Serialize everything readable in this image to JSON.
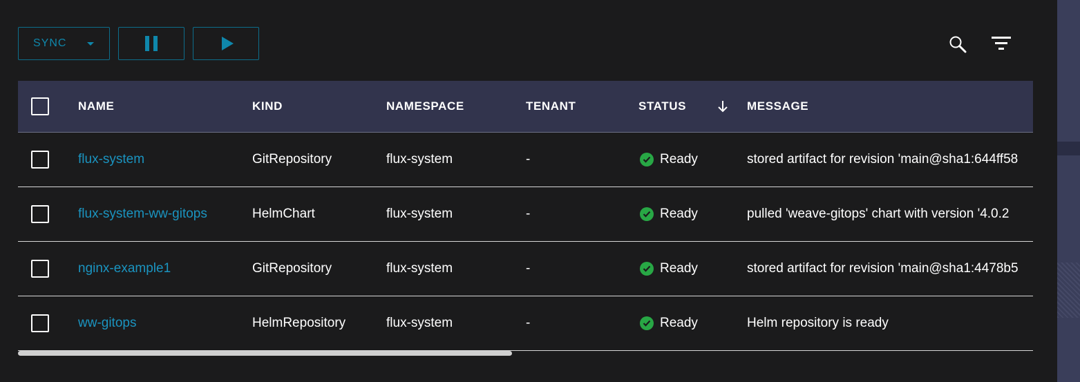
{
  "toolbar": {
    "sync_label": "SYNC"
  },
  "icons": {
    "search": "search-icon",
    "filter": "filter-icon",
    "pause": "pause-icon",
    "play": "play-icon",
    "sort": "arrow-down-icon",
    "status_ready": "check-circle-icon"
  },
  "colors": {
    "accent": "#0f87ab",
    "link": "#1b94c0",
    "header_bg": "#32344d",
    "ready_green": "#28a745"
  },
  "table": {
    "columns": [
      "NAME",
      "KIND",
      "NAMESPACE",
      "TENANT",
      "STATUS",
      "MESSAGE"
    ],
    "rows": [
      {
        "name": "flux-system",
        "kind": "GitRepository",
        "namespace": "flux-system",
        "tenant": "-",
        "status": "Ready",
        "message": "stored artifact for revision 'main@sha1:644ff58"
      },
      {
        "name": "flux-system-ww-gitops",
        "kind": "HelmChart",
        "namespace": "flux-system",
        "tenant": "-",
        "status": "Ready",
        "message": "pulled 'weave-gitops' chart with version '4.0.2"
      },
      {
        "name": "nginx-example1",
        "kind": "GitRepository",
        "namespace": "flux-system",
        "tenant": "-",
        "status": "Ready",
        "message": "stored artifact for revision 'main@sha1:4478b5"
      },
      {
        "name": "ww-gitops",
        "kind": "HelmRepository",
        "namespace": "flux-system",
        "tenant": "-",
        "status": "Ready",
        "message": "Helm repository is ready"
      }
    ]
  }
}
